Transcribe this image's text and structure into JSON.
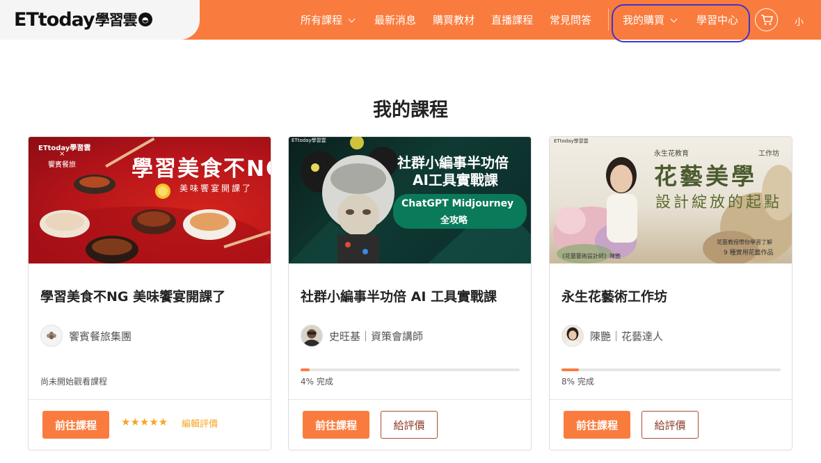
{
  "header": {
    "logo_brand": "ETtoday",
    "logo_sub": "學習雲",
    "nav": [
      {
        "label": "所有課程",
        "has_dropdown": true
      },
      {
        "label": "最新消息",
        "has_dropdown": false
      },
      {
        "label": "購買教材",
        "has_dropdown": false
      },
      {
        "label": "直播課程",
        "has_dropdown": false
      },
      {
        "label": "常見問答",
        "has_dropdown": false
      },
      {
        "label": "我的購買",
        "has_dropdown": true
      },
      {
        "label": "學習中心",
        "has_dropdown": false
      }
    ],
    "cart_icon": "cart-icon",
    "user_label": "小",
    "accent_color": "#f97c3e",
    "highlight_color": "#3b35c9"
  },
  "page": {
    "title": "我的課程"
  },
  "courses": [
    {
      "title": "學習美食不NG 美味饗宴開課了",
      "instructor": "饗賓餐旅集團",
      "status": "尚未開始觀看課程",
      "progress": null,
      "primary_button": "前往課程",
      "rating_stars": 5,
      "rating_text": "★★★★★",
      "edit_review": "編輯評價",
      "thumb": {
        "brand": "ETtoday學習雲",
        "x": "×",
        "partner": "饗賓餐旅",
        "headline": "學習美食不NG",
        "subline": "美味饗宴開課了"
      }
    },
    {
      "title": "社群小編事半功倍 AI 工具實戰課",
      "instructor": "史旺基｜資策會講師",
      "status": "4% 完成",
      "progress": 4,
      "primary_button": "前往課程",
      "secondary_button": "給評價",
      "thumb": {
        "brand": "ETtoday學習雲",
        "headline1": "社群小編事半功倍",
        "headline2": "AI工具實戰課",
        "badge1": "ChatGPT Midjourney",
        "badge2": "全攻略"
      }
    },
    {
      "title": "永生花藝術工作坊",
      "instructor": "陳艷｜花藝達人",
      "status": "8% 完成",
      "progress": 8,
      "primary_button": "前往課程",
      "secondary_button": "給評價",
      "thumb": {
        "brand": "ETtoday學習雲",
        "small_left": "永生花教育",
        "small_right": "工作坊",
        "headline1": "花藝美學",
        "headline2": "設計綻放的起點",
        "caption1": "花藝教授帶你學習了解",
        "caption2": "9 種實用花藝作品",
        "teacher": "《花藝藝術設計師》陳艷"
      }
    }
  ]
}
